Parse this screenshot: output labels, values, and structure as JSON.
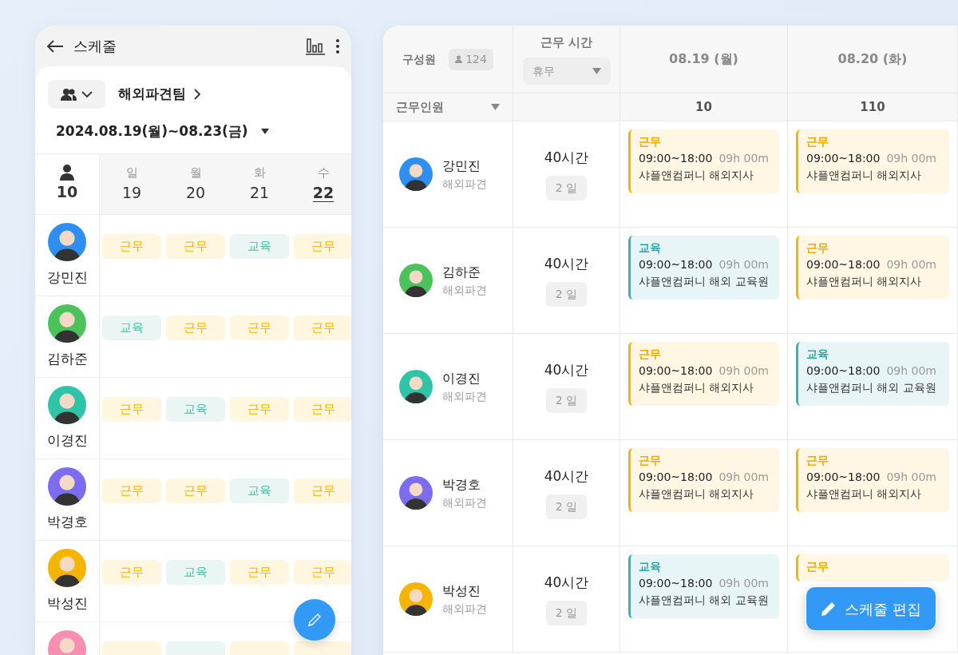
{
  "mobile": {
    "title": "스케줄",
    "team": "해외파견팀",
    "date_range": "2024.08.19(월)~08.23(금)",
    "member_count": "10",
    "days": [
      {
        "weekday": "일",
        "date": "19",
        "selected": false
      },
      {
        "weekday": "월",
        "date": "20",
        "selected": false
      },
      {
        "weekday": "화",
        "date": "21",
        "selected": false
      },
      {
        "weekday": "수",
        "date": "22",
        "selected": true
      }
    ],
    "members": [
      {
        "name": "강민진",
        "color": "#2f8ff0",
        "shifts": [
          {
            "kind": "work",
            "label": "근무"
          },
          {
            "kind": "work",
            "label": "근무"
          },
          {
            "kind": "education",
            "label": "교육"
          },
          {
            "kind": "work",
            "label": "근무"
          }
        ]
      },
      {
        "name": "김하준",
        "color": "#4cc35a",
        "shifts": [
          {
            "kind": "education",
            "label": "교육"
          },
          {
            "kind": "work",
            "label": "근무"
          },
          {
            "kind": "work",
            "label": "근무"
          },
          {
            "kind": "work",
            "label": "근무"
          }
        ]
      },
      {
        "name": "이경진",
        "color": "#2fc4a8",
        "shifts": [
          {
            "kind": "work",
            "label": "근무"
          },
          {
            "kind": "education",
            "label": "교육"
          },
          {
            "kind": "work",
            "label": "근무"
          },
          {
            "kind": "work",
            "label": "근무"
          }
        ]
      },
      {
        "name": "박경호",
        "color": "#7b6cf0",
        "shifts": [
          {
            "kind": "work",
            "label": "근무"
          },
          {
            "kind": "work",
            "label": "근무"
          },
          {
            "kind": "education",
            "label": "교육"
          },
          {
            "kind": "work",
            "label": "근무"
          }
        ]
      },
      {
        "name": "박성진",
        "color": "#f5b400",
        "shifts": [
          {
            "kind": "work",
            "label": "근무"
          },
          {
            "kind": "education",
            "label": "교육"
          },
          {
            "kind": "work",
            "label": "근무"
          },
          {
            "kind": "work",
            "label": "근무"
          }
        ]
      },
      {
        "color": "#f78fb3",
        "shifts": [
          {
            "kind": "work"
          },
          {
            "kind": "education"
          },
          {
            "kind": "work"
          },
          {
            "kind": "work"
          }
        ]
      }
    ]
  },
  "desktop": {
    "columns": {
      "member": "구성원",
      "member_count": "124",
      "hours": "근무 시간",
      "hours_filter": "휴무",
      "staff_filter": "근무인원",
      "dates": [
        {
          "label": "08.19 (월)",
          "count": "10"
        },
        {
          "label": "08.20 (화)",
          "count": "110"
        }
      ]
    },
    "rows": [
      {
        "name": "강민진",
        "team": "해외파견",
        "color": "#2f8ff0",
        "hours": "40시간",
        "days": "2 일",
        "shifts": [
          {
            "kind": "work",
            "label": "근무",
            "time": "09:00~18:00",
            "duration": "09h 00m",
            "place": "샤플앤컴퍼니 해외지사"
          },
          {
            "kind": "work",
            "label": "근무",
            "time": "09:00~18:00",
            "duration": "09h 00m",
            "place": "샤플앤컴퍼니 해외지사"
          }
        ]
      },
      {
        "name": "김하준",
        "team": "해외파견",
        "color": "#4cc35a",
        "hours": "40시간",
        "days": "2 일",
        "shifts": [
          {
            "kind": "education",
            "label": "교육",
            "time": "09:00~18:00",
            "duration": "09h 00m",
            "place": "샤플앤컴퍼니 해외 교육원"
          },
          {
            "kind": "work",
            "label": "근무",
            "time": "09:00~18:00",
            "duration": "09h 00m",
            "place": "샤플앤컴퍼니 해외지사"
          }
        ]
      },
      {
        "name": "이경진",
        "team": "해외파견",
        "color": "#2fc4a8",
        "hours": "40시간",
        "days": "2 일",
        "shifts": [
          {
            "kind": "work",
            "label": "근무",
            "time": "09:00~18:00",
            "duration": "09h 00m",
            "place": "샤플앤컴퍼니 해외지사"
          },
          {
            "kind": "education",
            "label": "교육",
            "time": "09:00~18:00",
            "duration": "09h 00m",
            "place": "샤플앤컴퍼니 해외 교육원"
          }
        ]
      },
      {
        "name": "박경호",
        "team": "해외파견",
        "color": "#7b6cf0",
        "hours": "40시간",
        "days": "2 일",
        "shifts": [
          {
            "kind": "work",
            "label": "근무",
            "time": "09:00~18:00",
            "duration": "09h 00m",
            "place": "샤플앤컴퍼니 해외지사"
          },
          {
            "kind": "work",
            "label": "근무",
            "time": "09:00~18:00",
            "duration": "09h 00m",
            "place": "샤플앤컴퍼니 해외지사"
          }
        ]
      },
      {
        "name": "박성진",
        "team": "해외파견",
        "color": "#f5b400",
        "hours": "40시간",
        "days": "2 일",
        "shifts": [
          {
            "kind": "education",
            "label": "교육",
            "time": "09:00~18:00",
            "duration": "09h 00m",
            "place": "샤플앤컴퍼니 해외 교육원"
          },
          {
            "kind": "work",
            "label": "근무"
          }
        ]
      }
    ]
  },
  "edit_button": "스케줄 편집"
}
